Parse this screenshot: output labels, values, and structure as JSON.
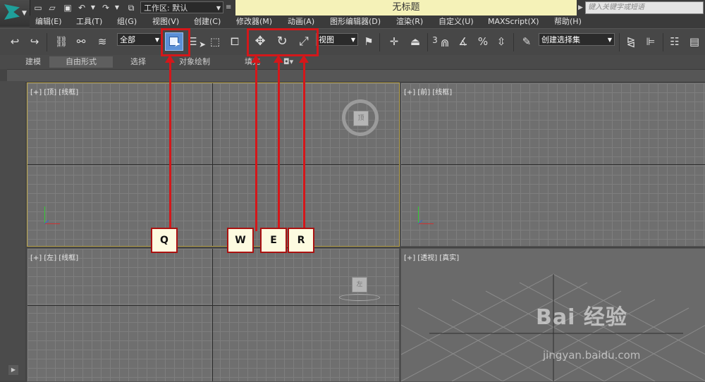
{
  "titlebar": {
    "workspace": "工作区: 默认",
    "title": "无标题",
    "search_placeholder": "键入关键字或短语"
  },
  "menu": [
    "编辑(E)",
    "工具(T)",
    "组(G)",
    "视图(V)",
    "创建(C)",
    "修改器(M)",
    "动画(A)",
    "图形编辑器(D)",
    "渲染(R)",
    "自定义(U)",
    "MAXScript(X)",
    "帮助(H)"
  ],
  "toolbar": {
    "filter": "全部",
    "ref_coord": "视图",
    "snap_3": "3",
    "selection_set": "创建选择集"
  },
  "ribbon": {
    "tabs": [
      "建模",
      "自由形式",
      "选择",
      "对象绘制",
      "填充"
    ]
  },
  "viewports": {
    "top": "[+] [顶] [线框]",
    "front": "[+] [前] [线框]",
    "left": "[+] [左] [线框]",
    "perspective": "[+] [透视] [真实]",
    "top_cube": "顶",
    "left_cube": "左"
  },
  "annotations": {
    "keys": [
      "Q",
      "W",
      "E",
      "R"
    ],
    "color": "#d4171a"
  },
  "watermark": {
    "main": "Bai 经验",
    "sub": "jingyan.baidu.com"
  }
}
